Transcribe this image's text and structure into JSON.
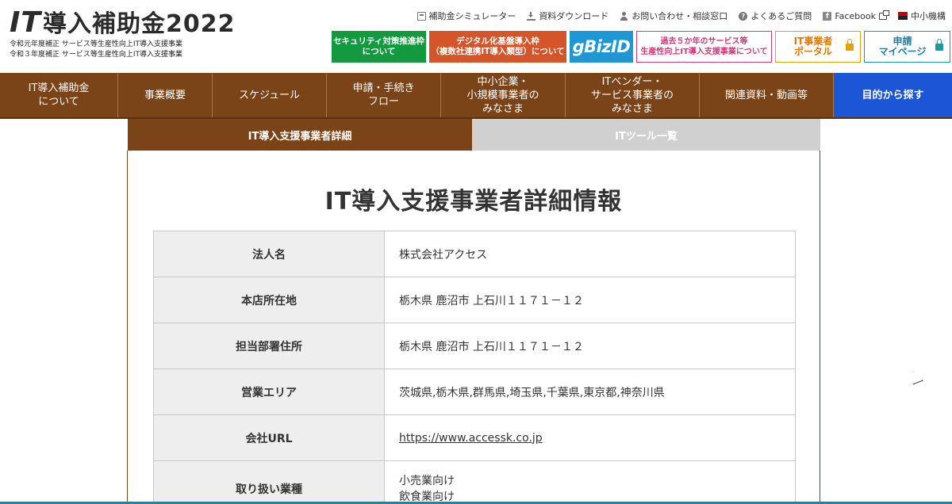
{
  "logo": {
    "it": "IT",
    "title": "導入補助金2022",
    "sub1": "令和元年度補正 サービス等生産性向上IT導入支援事業",
    "sub2": "令和３年度補正 サービス等生産性向上IT導入支援事業"
  },
  "toplinks": {
    "simulator": "補助金シミュレーター",
    "download": "資料ダウンロード",
    "contact": "お問い合わせ・相談窓口",
    "faq": "よくあるご質問",
    "facebook": "Facebook",
    "smrj": "中小機構"
  },
  "banners": {
    "security_1": "セキュリティ対策推進枠",
    "security_2": "について",
    "digital_1": "デジタル化基盤導入枠",
    "digital_2": "（複数社連携IT導入類型）について",
    "gbiz": "gBizID",
    "past_1": "過去５か年のサービス等",
    "past_2": "生産性向上IT導入支援事業について",
    "portal_1": "IT事業者",
    "portal_2": "ポータル",
    "mypage_1": "申請",
    "mypage_2": "マイページ"
  },
  "nav": {
    "item1_1": "IT導入補助金",
    "item1_2": "について",
    "item2": "事業概要",
    "item3": "スケジュール",
    "item4_1": "申請・手続き",
    "item4_2": "フロー",
    "item5_1": "中小企業・",
    "item5_2": "小規模事業者の",
    "item5_3": "みなさま",
    "item6_1": "ITベンダー・",
    "item6_2": "サービス事業者の",
    "item6_3": "みなさま",
    "item7": "関連資料・動画等",
    "item8": "目的から探す"
  },
  "tabs": {
    "active": "IT導入支援事業者詳細",
    "inactive": "ITツール一覧"
  },
  "main": {
    "title": "IT導入支援事業者詳細情報"
  },
  "details": {
    "company_label": "法人名",
    "company_value": "株式会社アクセス",
    "hq_label": "本店所在地",
    "hq_value": "栃木県 鹿沼市 上石川１１７１－１２",
    "office_label": "担当部署住所",
    "office_value": "栃木県 鹿沼市 上石川１１７１－１２",
    "area_label": "営業エリア",
    "area_value": "茨城県,栃木県,群馬県,埼玉県,千葉県,東京都,神奈川県",
    "url_label": "会社URL",
    "url_value": "https://www.accessk.co.jp",
    "industry_label": "取り扱い業種",
    "industry_1": "小売業向け",
    "industry_2": "飲食業向け"
  },
  "colors": {
    "brown": "#7b4418",
    "blue": "#1c56d6",
    "green": "#139a3e",
    "orange": "#d4552a",
    "gbiz": "#1e97d4"
  }
}
